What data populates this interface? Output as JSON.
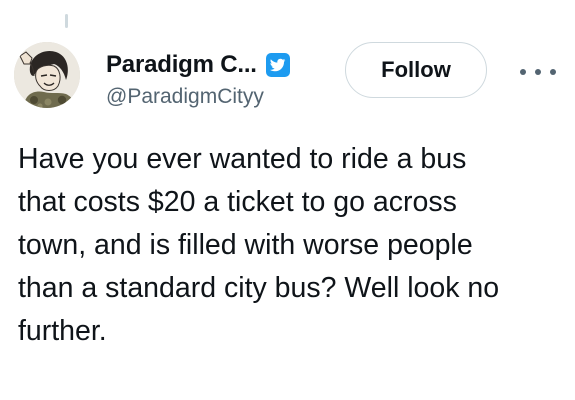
{
  "author": {
    "display_name": "Paradigm C...",
    "handle": "@ParadigmCityy",
    "verified_icon": "verified-badge-icon",
    "avatar_icon": "avatar-image"
  },
  "actions": {
    "follow_label": "Follow",
    "more_icon": "more-options-icon"
  },
  "tweet": {
    "lines": [
      "Have you ever wanted to ride a bus",
      "that costs $20 a ticket to go across",
      "town, and is filled with worse people",
      "than a standard city bus? Well look no",
      "further."
    ]
  },
  "colors": {
    "text_primary": "#0f1419",
    "text_secondary": "#536471",
    "verified_blue": "#1d9bf0",
    "button_border": "#cfd9de"
  }
}
